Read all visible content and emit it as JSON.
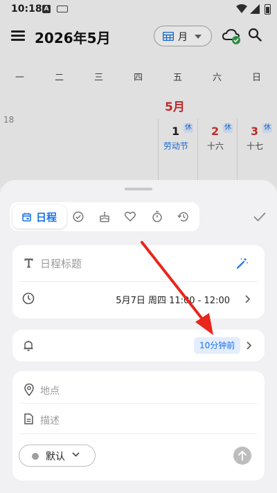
{
  "status_bar": {
    "time": "10:18",
    "keyboard_badge": "A"
  },
  "header": {
    "title": "2026年5月",
    "view_mode": "月"
  },
  "weekdays": [
    "一",
    "二",
    "三",
    "四",
    "五",
    "六",
    "日"
  ],
  "calendar": {
    "month_label": "5月",
    "week_number": "18",
    "days": [
      {
        "num": "1",
        "badge": "休",
        "sub": "劳动节"
      },
      {
        "num": "2",
        "badge": "休",
        "sub": "十六"
      },
      {
        "num": "3",
        "badge": "休",
        "sub": "十七"
      }
    ]
  },
  "sheet": {
    "active_tab": "日程",
    "title_placeholder": "日程标题",
    "time_range": "5月7日 周四 11:00 - 12:00",
    "reminder": "10分钟前",
    "location_placeholder": "地点",
    "description_placeholder": "描述",
    "calendar_selected": "默认"
  },
  "colors": {
    "accent": "#1a73e8",
    "holiday_red": "#d32f2f",
    "arrow": "#e8261c"
  }
}
